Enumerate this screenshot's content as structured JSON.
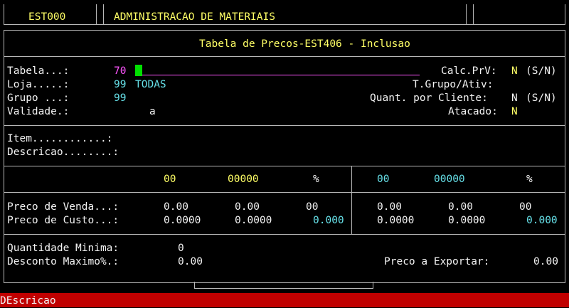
{
  "header": {
    "code": "EST000",
    "title": "ADMINISTRACAO DE MATERIAIS"
  },
  "screen_title": "Tabela de Precos-EST406 - Inclusao",
  "fields": {
    "tabela_label": "Tabela...:",
    "tabela_value": "70",
    "loja_label": "Loja.....:",
    "loja_value": "99",
    "loja_name": "TODAS",
    "grupo_label": "Grupo ...:",
    "grupo_value": "99",
    "validade_label": "Validade.:",
    "validade_value": "a",
    "calc_label": "Calc.PrV:",
    "calc_value": "N",
    "calc_hint": "(S/N)",
    "tgrupo_label": "T.Grupo/Ativ:",
    "quant_label": "Quant. por Cliente:",
    "quant_value": "N",
    "quant_hint": "(S/N)",
    "atacado_label": "Atacado:",
    "atacado_value": "N",
    "item_label": "Item............:",
    "descricao_label": "Descricao........:"
  },
  "prices": {
    "left_headers": [
      "00",
      "00000",
      "%"
    ],
    "right_headers": [
      "00",
      "00000",
      "%"
    ],
    "venda_label": "Preco de Venda...:",
    "venda_left": [
      "0.00",
      "0.00",
      "00"
    ],
    "venda_right": [
      "0.00",
      "0.00",
      "00"
    ],
    "custo_label": "Preco de Custo...:",
    "custo_left": [
      "0.0000",
      "0.0000",
      "0.000"
    ],
    "custo_right": [
      "0.0000",
      "0.0000",
      "0.000"
    ]
  },
  "bottom": {
    "qtd_label": "Quantidade Minima:",
    "qtd_value": "0",
    "desc_label": "Desconto Maximo%.:",
    "desc_value": "0.00",
    "export_label": "Preco a Exportar:",
    "export_value": "0.00"
  },
  "status_text": "DEscricao",
  "colors": {
    "yellow": "#ffff66",
    "cyan": "#66e0e8",
    "magenta": "#ff55ff",
    "cursor": "#00e000",
    "status_bg": "#c00000"
  }
}
